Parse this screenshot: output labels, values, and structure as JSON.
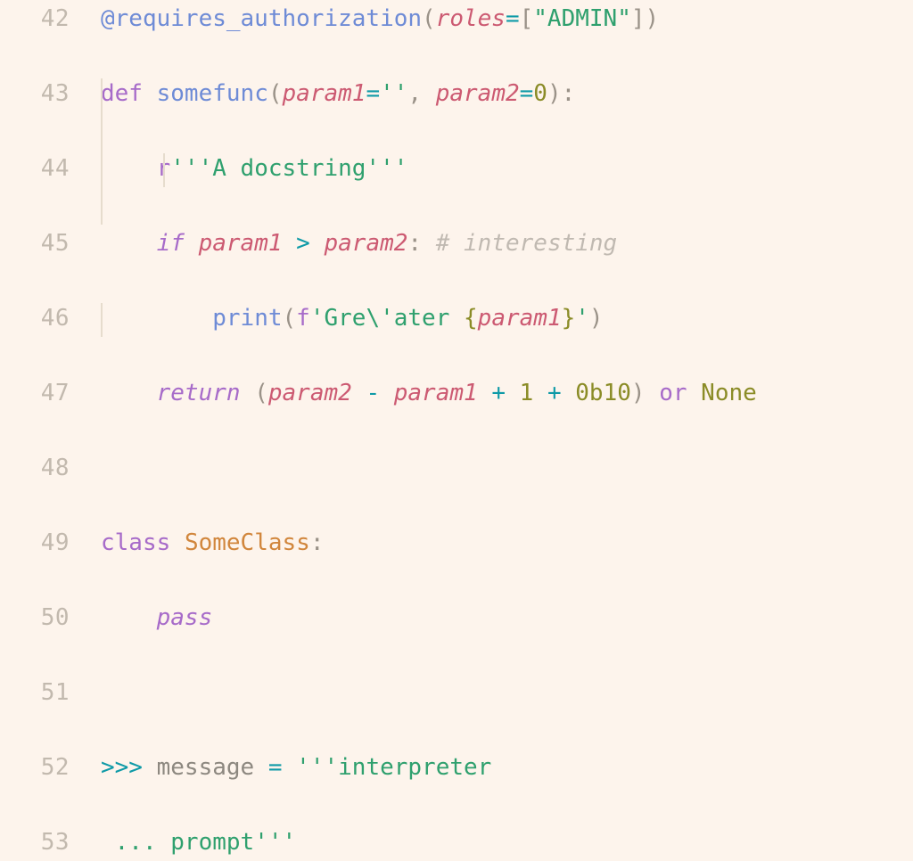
{
  "editor": {
    "theme_name": "light-warm",
    "language": "python",
    "background_color": "#fdf4ec",
    "gutter_color": "#c2b9ae",
    "indent_guide_color": "#e6dccd",
    "first_line_number": 42,
    "last_line_number": 53,
    "line_height_px": 42,
    "font_size_px": 26,
    "palette": {
      "decorator": "#6e8bd6",
      "function_name": "#6e8bd6",
      "keyword": "#a76bc9",
      "parameter": "#cc5a72",
      "string": "#2fa06e",
      "number": "#8b8c27",
      "constant": "#8b8c27",
      "operator": "#0e9aa7",
      "punctuation": "#9a9288",
      "comment": "#c0b9b1",
      "class_name": "#d1863c",
      "prompt": "#0e9aa7",
      "plain_text": "#8d8880"
    }
  },
  "lines": [
    {
      "number": "42",
      "indent_guides": 0,
      "tokens": [
        {
          "text": "@requires_authorization",
          "type": "decorator"
        },
        {
          "text": "(",
          "type": "punct"
        },
        {
          "text": "roles",
          "type": "param"
        },
        {
          "text": "=",
          "type": "operator"
        },
        {
          "text": "[",
          "type": "punct"
        },
        {
          "text": "\"ADMIN\"",
          "type": "string"
        },
        {
          "text": "]",
          "type": "punct"
        },
        {
          "text": ")",
          "type": "punct"
        }
      ]
    },
    {
      "number": "43",
      "indent_guides": 0,
      "tokens": [
        {
          "text": "def",
          "type": "kw"
        },
        {
          "text": " ",
          "type": "plain"
        },
        {
          "text": "somefunc",
          "type": "funcname"
        },
        {
          "text": "(",
          "type": "punct"
        },
        {
          "text": "param1",
          "type": "param"
        },
        {
          "text": "=",
          "type": "operator"
        },
        {
          "text": "''",
          "type": "string"
        },
        {
          "text": ",",
          "type": "punct"
        },
        {
          "text": " ",
          "type": "plain"
        },
        {
          "text": "param2",
          "type": "param"
        },
        {
          "text": "=",
          "type": "operator"
        },
        {
          "text": "0",
          "type": "number"
        },
        {
          "text": ")",
          "type": "punct"
        },
        {
          "text": ":",
          "type": "punct"
        }
      ]
    },
    {
      "number": "44",
      "indent_guides": 1,
      "tokens": [
        {
          "text": "    ",
          "type": "plain"
        },
        {
          "text": "r",
          "type": "strprefix"
        },
        {
          "text": "'''A docstring'''",
          "type": "string"
        }
      ]
    },
    {
      "number": "45",
      "indent_guides": 1,
      "tokens": [
        {
          "text": "    ",
          "type": "plain"
        },
        {
          "text": "if",
          "type": "kw-it"
        },
        {
          "text": " ",
          "type": "plain"
        },
        {
          "text": "param1",
          "type": "param"
        },
        {
          "text": " ",
          "type": "plain"
        },
        {
          "text": ">",
          "type": "operator"
        },
        {
          "text": " ",
          "type": "plain"
        },
        {
          "text": "param2",
          "type": "param"
        },
        {
          "text": ":",
          "type": "punct"
        },
        {
          "text": " ",
          "type": "plain"
        },
        {
          "text": "# interesting",
          "type": "comment"
        }
      ]
    },
    {
      "number": "46",
      "indent_guides": 2,
      "tokens": [
        {
          "text": "        ",
          "type": "plain"
        },
        {
          "text": "print",
          "type": "builtin"
        },
        {
          "text": "(",
          "type": "punct"
        },
        {
          "text": "f",
          "type": "strprefix"
        },
        {
          "text": "'Gre\\'ater ",
          "type": "string"
        },
        {
          "text": "{",
          "type": "brace"
        },
        {
          "text": "param1",
          "type": "param"
        },
        {
          "text": "}",
          "type": "brace"
        },
        {
          "text": "'",
          "type": "string"
        },
        {
          "text": ")",
          "type": "punct"
        }
      ]
    },
    {
      "number": "47",
      "indent_guides": 1,
      "tokens": [
        {
          "text": "    ",
          "type": "plain"
        },
        {
          "text": "return",
          "type": "kw-it"
        },
        {
          "text": " ",
          "type": "plain"
        },
        {
          "text": "(",
          "type": "punct"
        },
        {
          "text": "param2",
          "type": "param"
        },
        {
          "text": " ",
          "type": "plain"
        },
        {
          "text": "-",
          "type": "operator"
        },
        {
          "text": " ",
          "type": "plain"
        },
        {
          "text": "param1",
          "type": "param"
        },
        {
          "text": " ",
          "type": "plain"
        },
        {
          "text": "+",
          "type": "operator"
        },
        {
          "text": " ",
          "type": "plain"
        },
        {
          "text": "1",
          "type": "number"
        },
        {
          "text": " ",
          "type": "plain"
        },
        {
          "text": "+",
          "type": "operator"
        },
        {
          "text": " ",
          "type": "plain"
        },
        {
          "text": "0b10",
          "type": "number"
        },
        {
          "text": ")",
          "type": "punct"
        },
        {
          "text": " ",
          "type": "plain"
        },
        {
          "text": "or",
          "type": "kw"
        },
        {
          "text": " ",
          "type": "plain"
        },
        {
          "text": "None",
          "type": "const"
        }
      ]
    },
    {
      "number": "48",
      "indent_guides": 0,
      "tokens": []
    },
    {
      "number": "49",
      "indent_guides": 0,
      "tokens": [
        {
          "text": "class",
          "type": "kw"
        },
        {
          "text": " ",
          "type": "plain"
        },
        {
          "text": "SomeClass",
          "type": "classname"
        },
        {
          "text": ":",
          "type": "punct"
        }
      ]
    },
    {
      "number": "50",
      "indent_guides": 1,
      "tokens": [
        {
          "text": "    ",
          "type": "plain"
        },
        {
          "text": "pass",
          "type": "kw-it"
        }
      ]
    },
    {
      "number": "51",
      "indent_guides": 0,
      "tokens": []
    },
    {
      "number": "52",
      "indent_guides": 0,
      "tokens": [
        {
          "text": ">>>",
          "type": "prompt"
        },
        {
          "text": " ",
          "type": "plain"
        },
        {
          "text": "message",
          "type": "plain"
        },
        {
          "text": " ",
          "type": "plain"
        },
        {
          "text": "=",
          "type": "operator"
        },
        {
          "text": " ",
          "type": "plain"
        },
        {
          "text": "'''interpreter",
          "type": "string"
        }
      ]
    },
    {
      "number": "53",
      "indent_guides": 0,
      "tokens": [
        {
          "text": " ",
          "type": "plain"
        },
        {
          "text": "...",
          "type": "string"
        },
        {
          "text": " ",
          "type": "plain"
        },
        {
          "text": "prompt'''",
          "type": "string"
        }
      ]
    }
  ]
}
